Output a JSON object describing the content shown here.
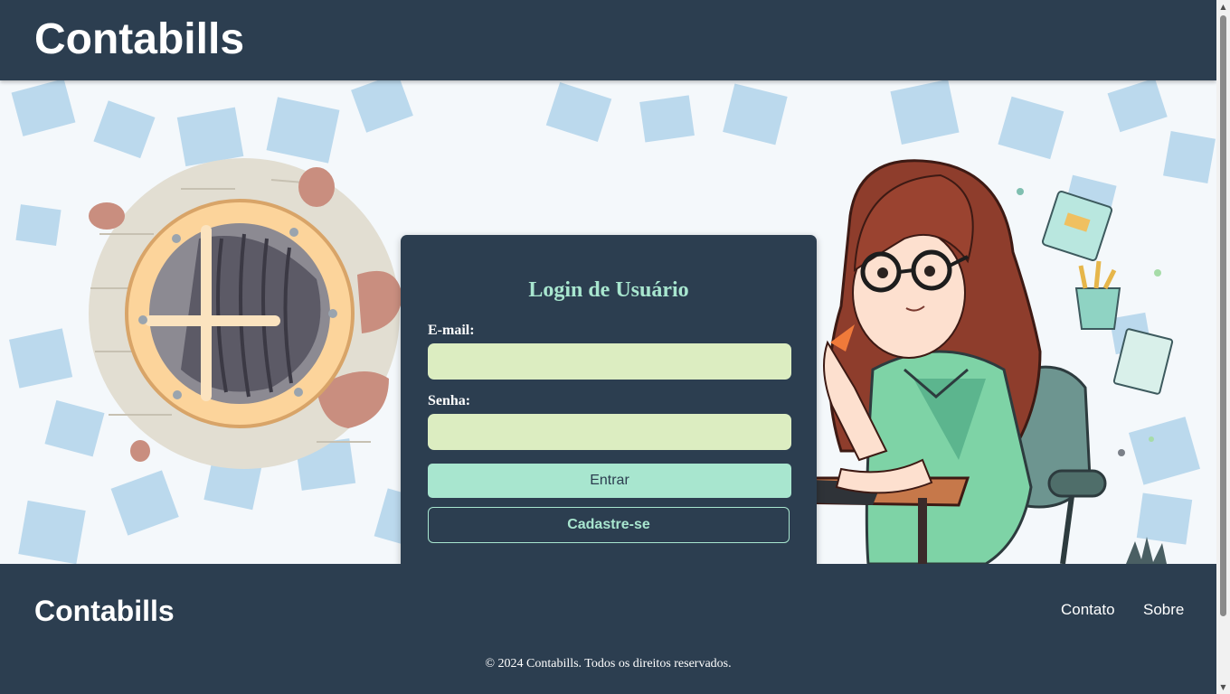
{
  "header": {
    "brand": "Contabills"
  },
  "login": {
    "title": "Login de Usuário",
    "email_label": "E-mail:",
    "email_value": "",
    "password_label": "Senha:",
    "password_value": "",
    "submit_label": "Entrar",
    "register_label": "Cadastre-se"
  },
  "footer": {
    "brand": "Contabills",
    "links": [
      "Contato",
      "Sobre"
    ],
    "copyright": "© 2024 Contabills. Todos os direitos reservados."
  },
  "icons": {
    "scroll_up": "scroll-up-arrow-icon",
    "scroll_down": "scroll-down-arrow-icon"
  },
  "colors": {
    "primary_dark": "#2c3e50",
    "accent_mint": "#a8e6cf",
    "input_bg": "#dcedc1",
    "text_light": "#ffffff"
  }
}
